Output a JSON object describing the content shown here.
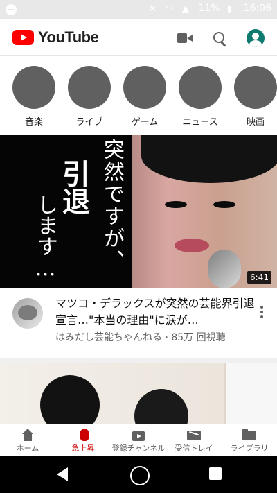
{
  "status_bar": {
    "battery_percent": "11%",
    "time": "16:06"
  },
  "app_bar": {
    "logo_text": "YouTube"
  },
  "chips": [
    {
      "label": "音楽",
      "icon": "music-note-icon"
    },
    {
      "label": "ライブ",
      "icon": "live-icon"
    },
    {
      "label": "ゲーム",
      "icon": "gamepad-icon"
    },
    {
      "label": "ニュース",
      "icon": "news-icon"
    },
    {
      "label": "映画",
      "icon": "film-icon"
    }
  ],
  "featured_video": {
    "thumbnail_text_1": "突然ですが、",
    "thumbnail_text_2": "引退",
    "thumbnail_text_3": "します…",
    "duration": "6:41",
    "title": "マツコ・デラックスが突然の芸能界引退宣言…\"本当の理由\"に涙が…",
    "subtitle": "はみだし芸能ちゃんねる · 85万 回視聴"
  },
  "bottom_nav": [
    {
      "label": "ホーム",
      "active": false
    },
    {
      "label": "急上昇",
      "active": true
    },
    {
      "label": "登録チャンネル",
      "active": false
    },
    {
      "label": "受信トレイ",
      "active": false
    },
    {
      "label": "ライブラリ",
      "active": false
    }
  ],
  "colors": {
    "brand_red": "#ff0000",
    "active_red": "#cc0000",
    "icon_gray": "#606060",
    "text_dark": "#0f0f0f"
  }
}
